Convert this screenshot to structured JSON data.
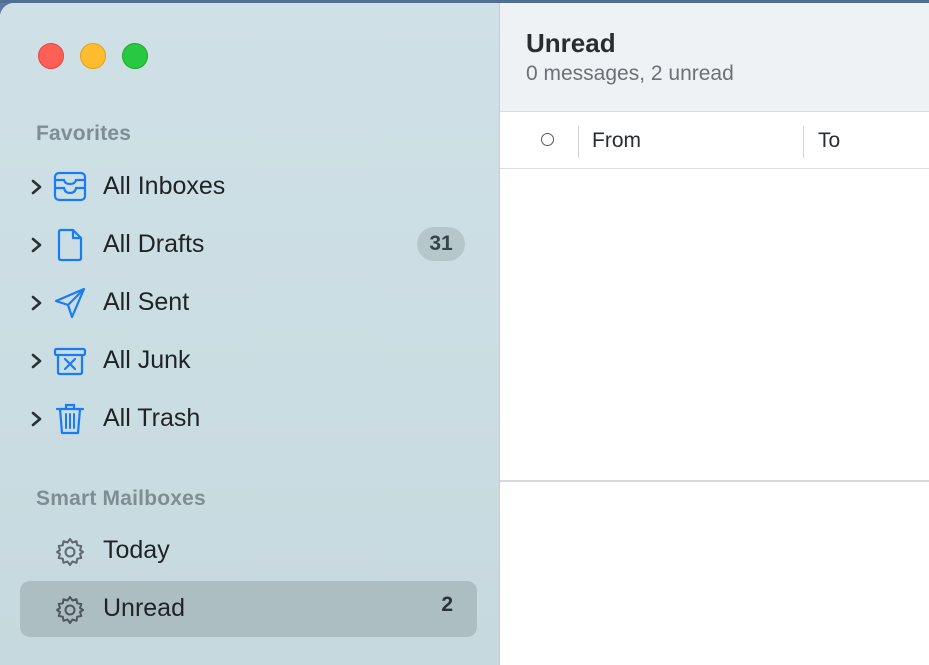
{
  "window": {
    "controls": [
      "close",
      "minimize",
      "zoom"
    ]
  },
  "sidebar": {
    "favorites_title": "Favorites",
    "favorites": [
      {
        "label": "All Inboxes",
        "icon": "tray-icon",
        "badge": ""
      },
      {
        "label": "All Drafts",
        "icon": "document-icon",
        "badge": "31"
      },
      {
        "label": "All Sent",
        "icon": "paper-plane-icon",
        "badge": ""
      },
      {
        "label": "All Junk",
        "icon": "junk-icon",
        "badge": ""
      },
      {
        "label": "All Trash",
        "icon": "trash-icon",
        "badge": ""
      }
    ],
    "smart_title": "Smart Mailboxes",
    "smart": [
      {
        "label": "Today",
        "icon": "gear-icon",
        "badge": "",
        "selected": false
      },
      {
        "label": "Unread",
        "icon": "gear-icon",
        "badge": "2",
        "selected": true
      }
    ]
  },
  "message_list": {
    "title": "Unread",
    "subtitle": "0 messages, 2 unread",
    "columns": [
      "From",
      "To"
    ]
  },
  "colors": {
    "accent": "#1a7cf5",
    "sidebar_bg": "#cbdee3",
    "selected_row": "#adbec3"
  }
}
